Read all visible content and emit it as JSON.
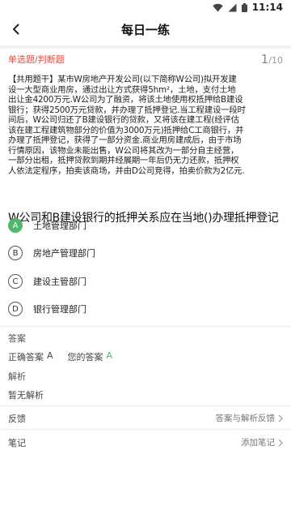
{
  "status_bar": {
    "time": "11:14"
  },
  "header": {
    "title": "每日一练"
  },
  "question": {
    "type_label": "单选题/判断题",
    "current": "1",
    "total": "/10",
    "stem_lines": [
      "【共用题干】某市W房地产开发公司(以下简称W公司)拟开发建",
      "设一大型商业用房，通过出让方式获得5hm²，土地，支付土地",
      "出让金4200万元.W公司为了融资，将该土地使用权抵押给B建设",
      "银行；获得2500万元贷款，并办理了抵押登记.当工程建设一段时",
      "间后，W公司归还了B建设银行的贷款，又将该在建工程(经评估",
      "该在建工程建筑物部分的价值为3000万元)抵押给C工商银行，并",
      "办理了抵押登记，获得了一部分资金.商业用房建成后，由于市场",
      "行情原因，该物业未能出售，W公司将其改为一部分自主经营，",
      "一部分出租，抵押贷款到期并经展期一年后仍无力还款，抵押权",
      "人依法定程序，拍卖该商场，并由D公司竞得，拍卖价款为2亿元."
    ],
    "prompt": "W公司和B建设银行的抵押关系应在当地()办理抵押登记",
    "options": [
      {
        "letter": "A",
        "text": "土地管理部门"
      },
      {
        "letter": "B",
        "text": "房地产管理部门"
      },
      {
        "letter": "C",
        "text": "建设主管部门"
      },
      {
        "letter": "D",
        "text": "银行管理部门"
      }
    ]
  },
  "answer_section": {
    "title": "答案",
    "correct_label": "正确答案",
    "correct_value": "A",
    "yours_label": "您的答案",
    "yours_value": "A"
  },
  "analysis_section": {
    "title": "解析",
    "content": "暂无解析"
  },
  "feedback_row": {
    "label": "反馈",
    "action": "答案与解析反馈"
  },
  "notes_row": {
    "label": "笔记",
    "action": "添加笔记"
  },
  "colors": {
    "accent_red": "#e64a3b",
    "correct_green": "#4cb86c"
  }
}
